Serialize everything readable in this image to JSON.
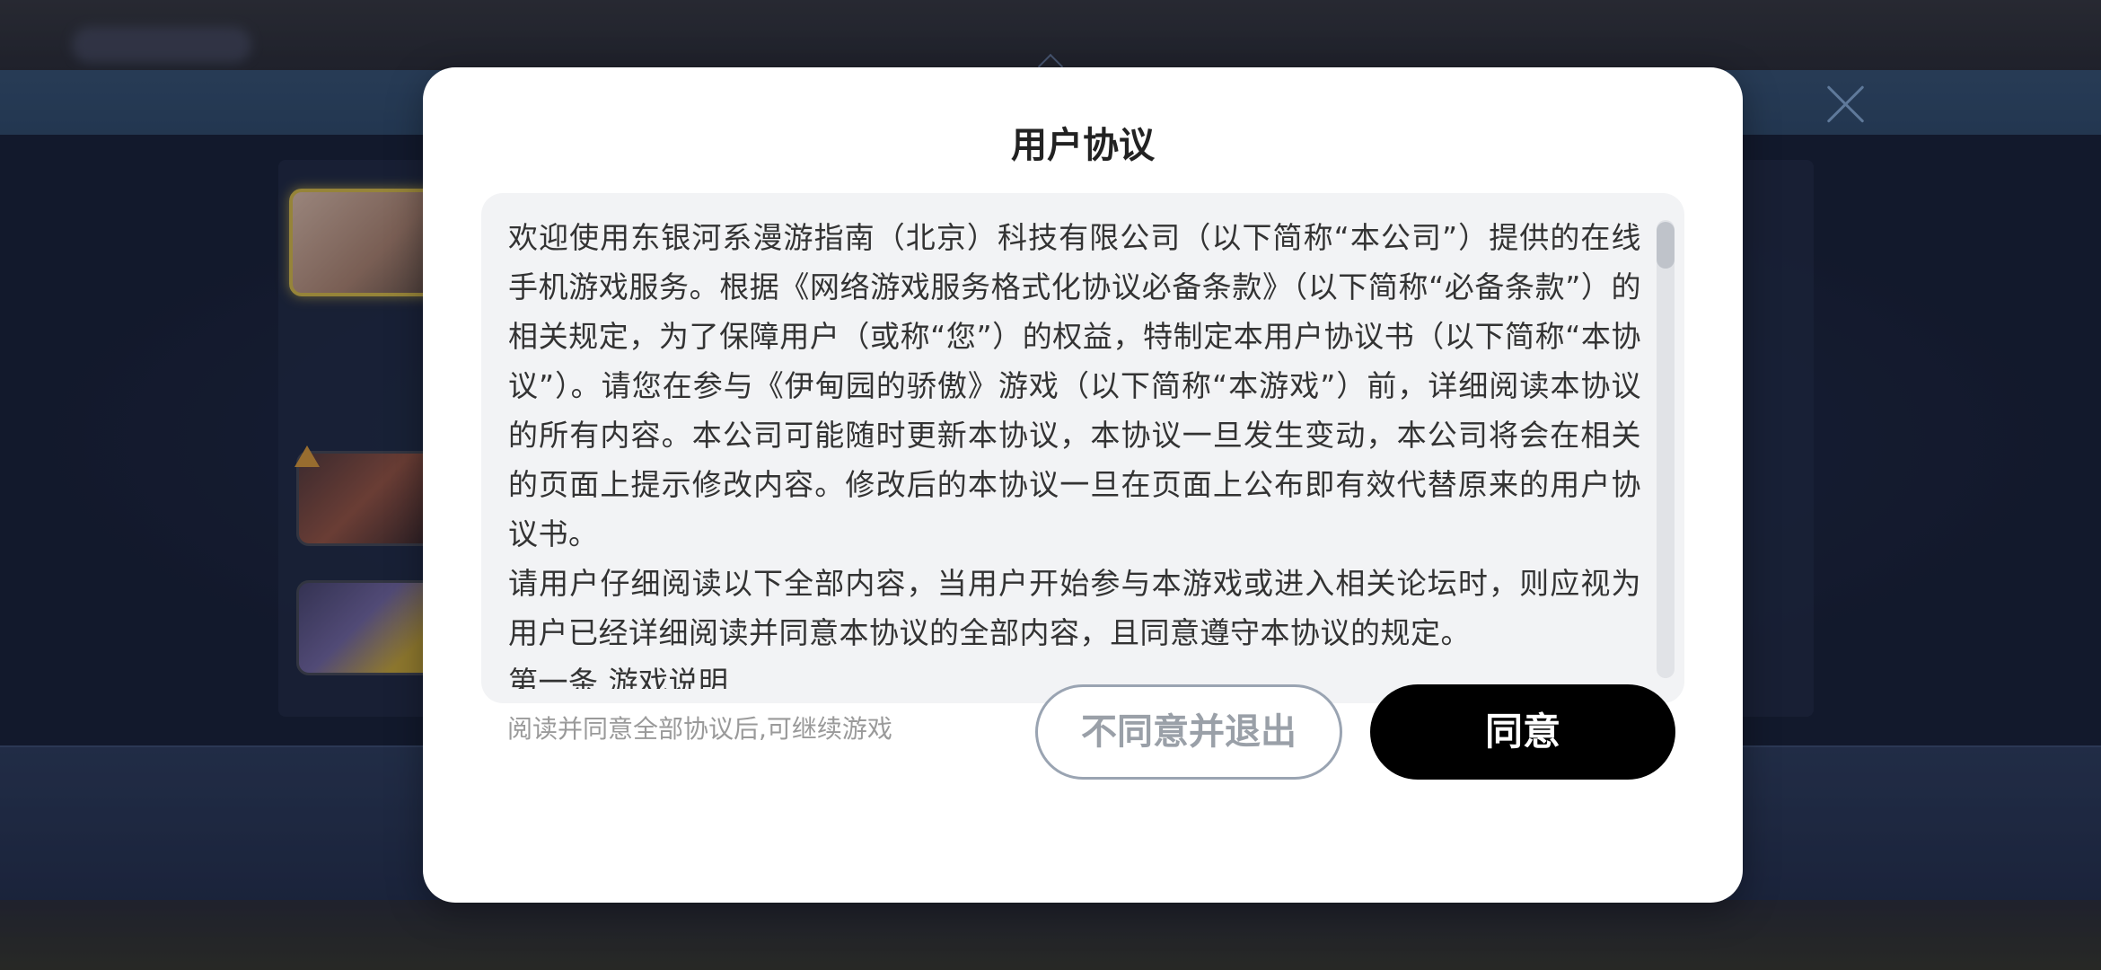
{
  "dialog": {
    "title": "用户协议",
    "agreement_paragraphs": [
      "欢迎使用东银河系漫游指南（北京）科技有限公司（以下简称“本公司”）提供的在线手机游戏服务。根据《网络游戏服务格式化协议必备条款》（以下简称“必备条款”）的相关规定，为了保障用户（或称“您”）的权益，特制定本用户协议书（以下简称“本协议”）。请您在参与《伊甸园的骄傲》游戏（以下简称“本游戏”）前，详细阅读本协议的所有内容。本公司可能随时更新本协议，本协议一旦发生变动，本公司将会在相关的页面上提示修改内容。修改后的本协议一旦在页面上公布即有效代替原来的用户协议书。",
      "请用户仔细阅读以下全部内容，当用户开始参与本游戏或进入相关论坛时，则应视为用户已经详细阅读并同意本协议的全部内容，且同意遵守本协议的规定。",
      "第一条 游戏说明"
    ],
    "hint": "阅读并同意全部协议后,可继续游戏",
    "disagree_label": "不同意并退出",
    "agree_label": "同意",
    "scroll_position": 0.0
  },
  "colors": {
    "agree_button": "#000000",
    "disagree_border": "#9aa4b2",
    "text_box_background": "#f2f3f5"
  },
  "icons": {
    "background_close": "close-icon",
    "background_warning": "warning-icon"
  }
}
